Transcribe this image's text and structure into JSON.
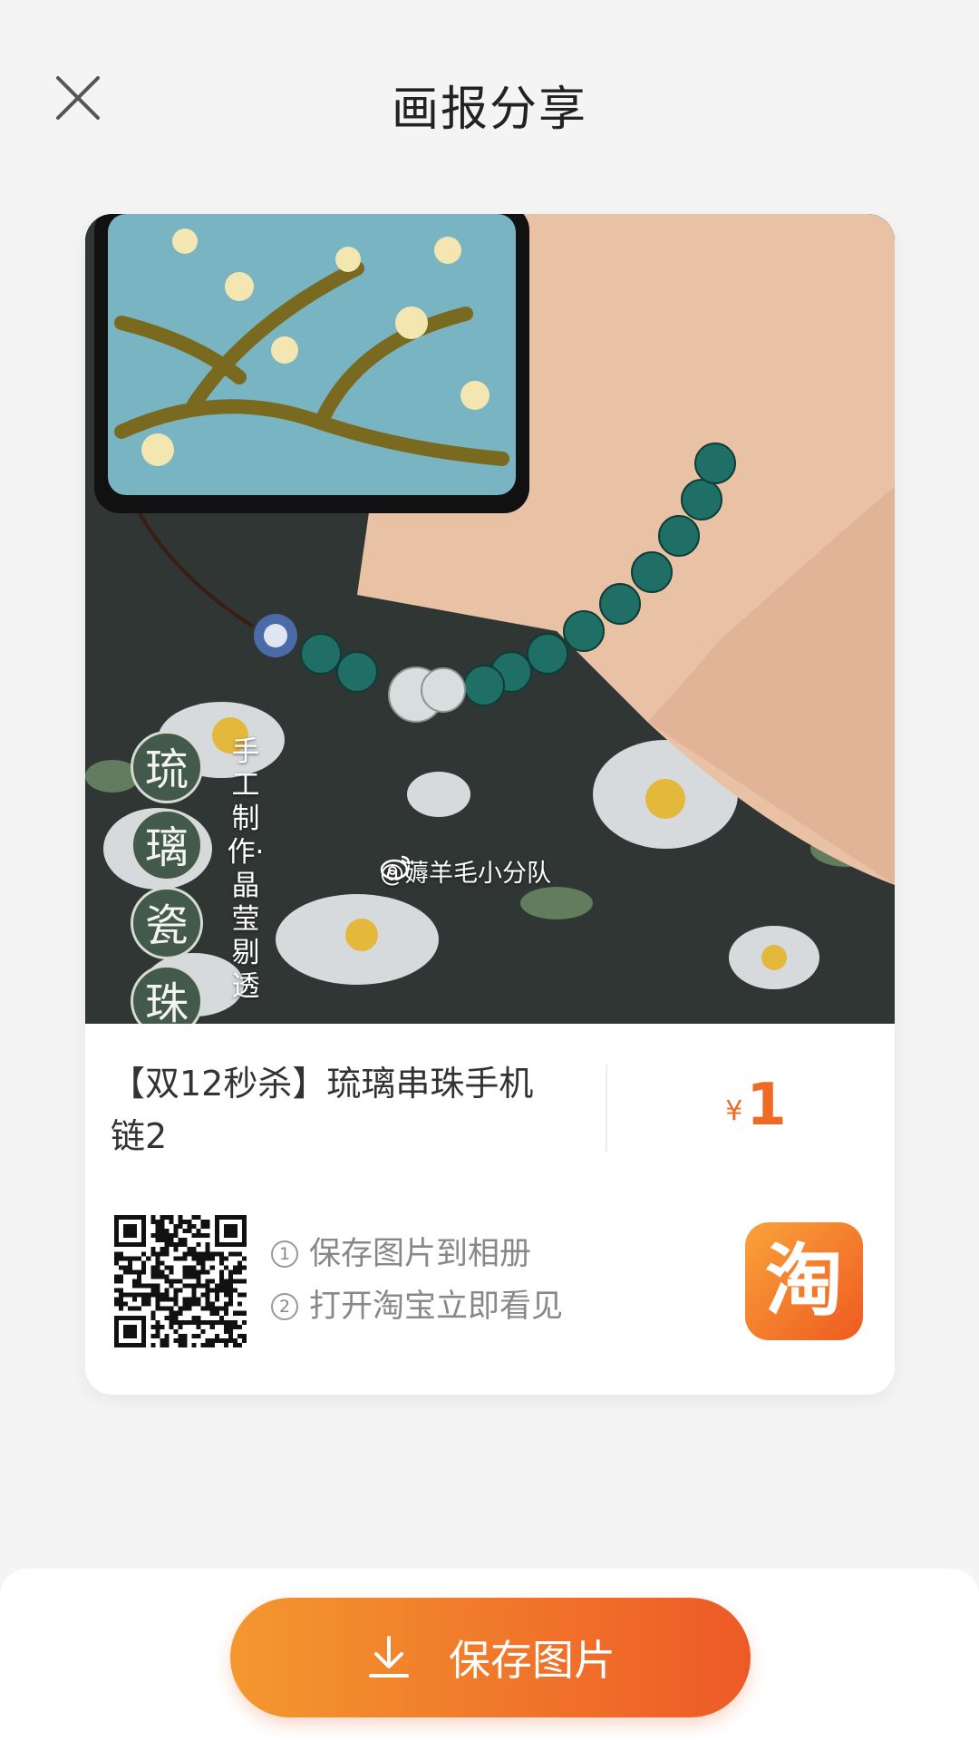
{
  "header": {
    "title": "画报分享",
    "close_icon": "close-icon"
  },
  "poster": {
    "vertical_title_chars": [
      "琉",
      "璃",
      "瓷",
      "珠"
    ],
    "vertical_subtitle": "手工制作·晶莹剔透",
    "watermark": "@薅羊毛小分队",
    "product_title": "【双12秒杀】琉璃串珠手机链2",
    "price_currency": "¥",
    "price_value": "1",
    "steps": [
      {
        "num": "1",
        "text": "保存图片到相册"
      },
      {
        "num": "2",
        "text": "打开淘宝立即看见"
      }
    ],
    "taobao_logo_text": "淘"
  },
  "footer": {
    "save_label": "保存图片",
    "save_icon": "download-icon"
  },
  "colors": {
    "accent": "#ef6a25",
    "button_start": "#f3982f",
    "button_end": "#ee5a27"
  }
}
